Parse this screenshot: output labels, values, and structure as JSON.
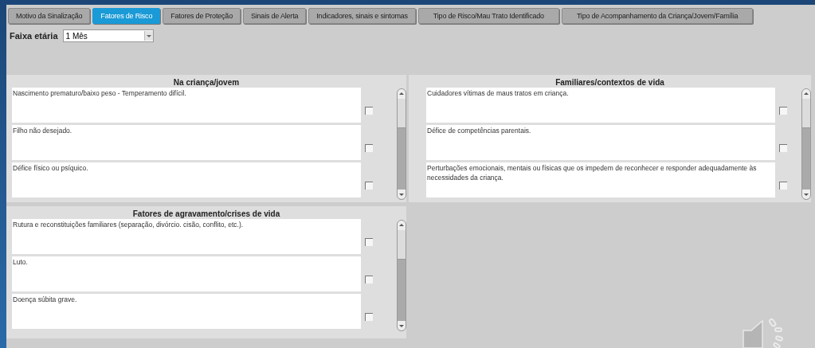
{
  "tabs": [
    {
      "label": "Motivo da Sinalização",
      "selected": false
    },
    {
      "label": "Fatores de Risco",
      "selected": true
    },
    {
      "label": "Fatores de Proteção",
      "selected": false
    },
    {
      "label": "Sinais de Alerta",
      "selected": false
    },
    {
      "label": "Indicadores, sinais e sintomas",
      "selected": false
    },
    {
      "label": "Tipo de Risco/Mau Trato Identificado",
      "selected": false
    },
    {
      "label": "Tipo de Acompanhamento da Criança/Jovem/Família",
      "selected": false
    }
  ],
  "age_filter": {
    "label": "Faixa etária",
    "value": "1 Mês"
  },
  "panels": [
    {
      "title": "Na criança/jovem",
      "items": [
        {
          "text": "Nascimento prematuro/baixo peso - Temperamento difícil.",
          "checked": false
        },
        {
          "text": "Filho não desejado.",
          "checked": false
        },
        {
          "text": "Défice físico ou psíquico.",
          "checked": false
        }
      ]
    },
    {
      "title": "Familiares/contextos de vida",
      "items": [
        {
          "text": "Cuidadores vítimas de maus tratos em criança.",
          "checked": false
        },
        {
          "text": "Défice de competências parentais.",
          "checked": false
        },
        {
          "text": "Perturbações emocionais, mentais ou físicas que os impedem de reconhecer e responder adequadamente às necessidades da criança.",
          "checked": false
        }
      ]
    },
    {
      "title": "Fatores de agravamento/crises de vida",
      "items": [
        {
          "text": "Rutura e reconstituições familiares (separação, divórcio. cisão, conflito, etc.).",
          "checked": false
        },
        {
          "text": "Luto.",
          "checked": false
        },
        {
          "text": "Doença súbita grave.",
          "checked": false
        }
      ]
    }
  ]
}
